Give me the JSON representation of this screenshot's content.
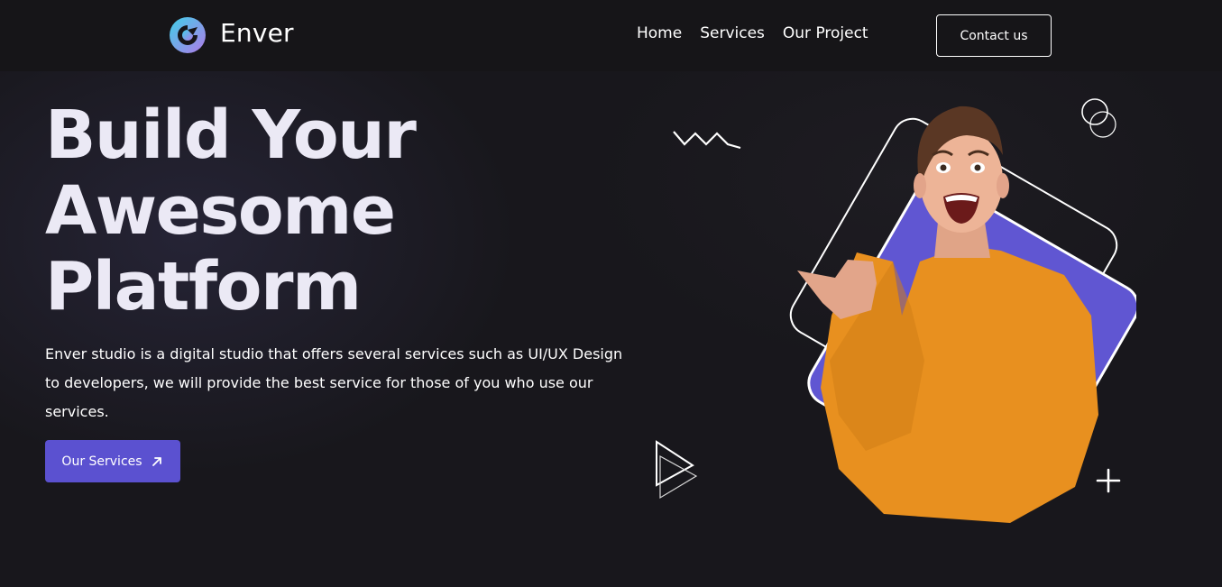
{
  "navbar": {
    "brand": "Enver",
    "links": [
      "Home",
      "Services",
      "Our Project"
    ],
    "contact_label": "Contact us"
  },
  "hero": {
    "title_lines": [
      "Build Your",
      "Awesome",
      "Platform"
    ],
    "description": "Enver studio is a digital studio that offers several services such as UI/UX Design to developers, we will provide the best service for those of you who use our services.",
    "cta_label": "Our Services"
  },
  "colors": {
    "background": "#18171c",
    "navbar": "#161518",
    "accent": "#5b51d0",
    "title": "#ebe9f5",
    "sweater": "#e8901f"
  },
  "icons": {
    "logo": "enver-logo-icon",
    "cta": "arrow-up-right-icon",
    "decorations": [
      "zigzag-icon",
      "double-circle-icon",
      "play-triangle-icon",
      "plus-icon"
    ]
  }
}
